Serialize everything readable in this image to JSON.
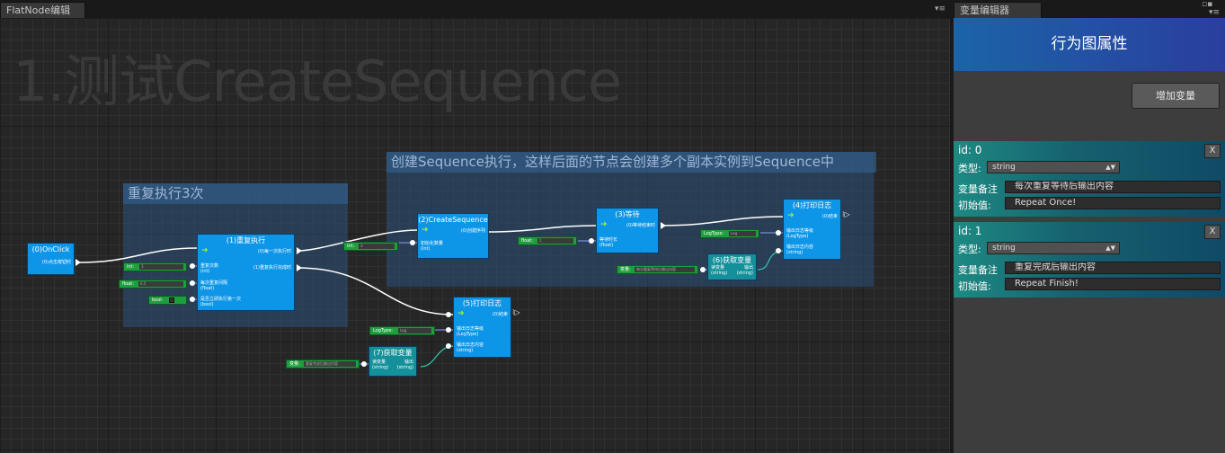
{
  "tabs": {
    "editor": "FlatNode编辑器",
    "variables": "变量编辑器",
    "menu_glyph": "▾≡"
  },
  "graph_title": "1.测试CreateSequence",
  "groups": {
    "repeat": "重复执行3次",
    "sequence": "创建Sequence执行，这样后面的节点会创建多个副本实例到Sequence中"
  },
  "nodes": {
    "onclick": {
      "title": "(0)OnClick",
      "out": "(0)点击按钮时"
    },
    "repeat": {
      "title": "(1)重复执行",
      "out1": "(0)每一次执行时",
      "out2": "(1)重复执行完成时",
      "in1": "重复次数",
      "in1t": "(int)",
      "in2": "每次重复间隔",
      "in2t": "(float)",
      "in3": "是否立即执行第一次",
      "in3t": "(bool)"
    },
    "createseq": {
      "title": "(2)CreateSequence",
      "out": "(0)创建序列",
      "in": "初始化数量",
      "int": "(int)"
    },
    "wait": {
      "title": "(3)等待",
      "out": "(0)等待结束时",
      "in": "等待时长",
      "int": "(float)"
    },
    "log4": {
      "title": "(4)打印日志",
      "out": "(0)结束",
      "in1": "输出日志等级",
      "in1t": "(LogType)",
      "in2": "输出日志内容",
      "in2t": "(string)"
    },
    "log5": {
      "title": "(5)打印日志",
      "out": "(0)结束",
      "in1": "输出日志等级",
      "in1t": "(LogType)",
      "in2": "输出日志内容",
      "in2t": "(string)"
    },
    "getvar6": {
      "title": "(6)获取变量",
      "in": "读变量",
      "int": "(string)",
      "out": "输出",
      "outt": "(string)"
    },
    "getvar7": {
      "title": "(7)获取变量",
      "in": "读变量",
      "int": "(string)",
      "out": "输出",
      "outt": "(string)"
    }
  },
  "inputs": {
    "int_label": "int:",
    "int_value": "3",
    "float_label": "float:",
    "float_value": "0.5",
    "bool_label": "bool:",
    "seq_int_label": "int:",
    "seq_int_value": "3",
    "wait_float_label": "float:",
    "wait_float_value": "1",
    "logtype_label": "LogType:",
    "logtype_value": "Log",
    "var_label": "变量:",
    "var6_value": "每次重复等待后输出内容",
    "logtype5_label": "LogType:",
    "logtype5_value": "Log",
    "var7_label": "变量:",
    "var7_value": "重复完成后输出内容"
  },
  "panel": {
    "header": "行为图属性",
    "add_button": "增加变量",
    "variables": [
      {
        "id": "id: 0",
        "type_label": "类型:",
        "type": "string",
        "note_label": "变量备注",
        "note": "每次重复等待后输出内容",
        "init_label": "初始值:",
        "init": "Repeat Once!",
        "close": "X"
      },
      {
        "id": "id: 1",
        "type_label": "类型:",
        "type": "string",
        "note_label": "变量备注",
        "note": "重复完成后输出内容",
        "init_label": "初始值:",
        "init": "Repeat Finish!",
        "close": "X"
      }
    ]
  },
  "colors": {
    "node": "#0d96e8",
    "var_input": "#1f9e3f",
    "getvar_node": "#13909a",
    "accent_green": "#9cf03a"
  }
}
